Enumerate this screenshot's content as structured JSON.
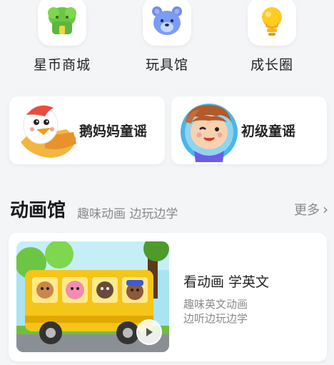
{
  "top_nav": [
    {
      "label": "星币商城",
      "icon": "green-house-icon"
    },
    {
      "label": "玩具馆",
      "icon": "bear-icon"
    },
    {
      "label": "成长圈",
      "icon": "lightbulb-icon"
    }
  ],
  "cards": [
    {
      "title": "鹅妈妈童谣",
      "icon": "goose-character-icon"
    },
    {
      "title": "初级童谣",
      "icon": "boy-character-icon"
    }
  ],
  "section": {
    "title": "动画馆",
    "subtitle": "趣味动画 边玩边学",
    "more": "更多"
  },
  "video": {
    "title": "看动画 学英文",
    "desc_line1": "趣味英文动画",
    "desc_line2": "边听边玩边学"
  },
  "colors": {
    "background": "#f4f5f7",
    "card": "#ffffff",
    "text_primary": "#222222",
    "text_secondary": "#888888",
    "bus_yellow": "#f5c518"
  }
}
